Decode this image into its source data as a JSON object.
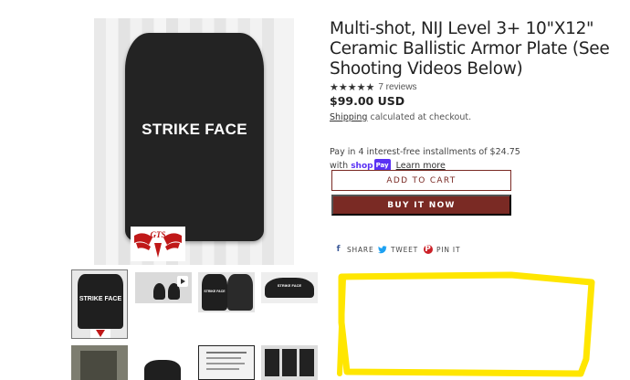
{
  "main_image": {
    "plate_text": "STRIKE FACE",
    "logo_text": "GTS"
  },
  "thumbnails": [
    {
      "plate_text": "STRIKE FACE",
      "selected": true
    },
    {
      "plate_text": "",
      "video": true
    },
    {
      "plate_text": "STRIKE FACE"
    },
    {
      "plate_text": "STRIKE FACE"
    },
    {
      "plate_text": ""
    },
    {
      "plate_text": ""
    },
    {
      "plate_text": ""
    },
    {
      "plate_text": ""
    }
  ],
  "product": {
    "title": "Multi-shot, NIJ Level 3+ 10\"X12\" Ceramic Ballistic Armor Plate (See Shooting Videos Below)",
    "stars": "★★★★★",
    "reviews": "7 reviews",
    "price": "$99.00 USD",
    "shipping_link": "Shipping",
    "shipping_rest": " calculated at checkout."
  },
  "installments": {
    "line1": "Pay in 4 interest-free installments of $24.75",
    "with": "with",
    "shop": "shop",
    "pay": "Pay",
    "learn_more": "Learn more"
  },
  "buttons": {
    "add_to_cart": "ADD TO CART",
    "buy_now": "BUY IT NOW"
  },
  "share": {
    "facebook": "SHARE",
    "twitter": "TWEET",
    "pinterest": "PIN IT"
  },
  "colors": {
    "button_accent": "#7a2a24",
    "highlight": "#ffe600",
    "shop_pay": "#5a31f4"
  }
}
